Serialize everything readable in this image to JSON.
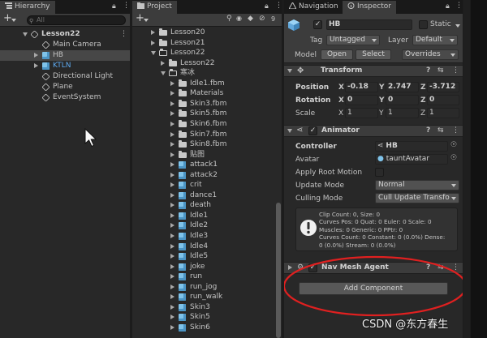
{
  "hierarchy": {
    "tab_label": "Hierarchy",
    "add_label": "+",
    "search_placeholder": "All",
    "items": [
      {
        "label": "Lesson22",
        "indent": 0,
        "expand": "down",
        "icon": "scene-icon",
        "selected": false,
        "bold": true
      },
      {
        "label": "Main Camera",
        "indent": 1,
        "expand": "",
        "icon": "gameobject-icon",
        "selected": false
      },
      {
        "label": "HB",
        "indent": 1,
        "expand": "right",
        "icon": "prefab-icon",
        "selected": true
      },
      {
        "label": "KTLN",
        "indent": 1,
        "expand": "right",
        "icon": "prefab-icon",
        "selected": false,
        "blue": true
      },
      {
        "label": "Directional Light",
        "indent": 1,
        "expand": "",
        "icon": "gameobject-icon",
        "selected": false
      },
      {
        "label": "Plane",
        "indent": 1,
        "expand": "",
        "icon": "gameobject-icon",
        "selected": false
      },
      {
        "label": "EventSystem",
        "indent": 1,
        "expand": "",
        "icon": "gameobject-icon",
        "selected": false
      }
    ]
  },
  "project": {
    "tab_label": "Project",
    "add_label": "+",
    "count_badge": "9",
    "items": [
      {
        "label": "Lesson20",
        "indent": 0,
        "expand": "right",
        "type": "folder"
      },
      {
        "label": "Lesson21",
        "indent": 0,
        "expand": "right",
        "type": "folder"
      },
      {
        "label": "Lesson22",
        "indent": 0,
        "expand": "down",
        "type": "folder-open"
      },
      {
        "label": "Lesson22",
        "indent": 1,
        "expand": "right",
        "type": "folder"
      },
      {
        "label": "寒冰",
        "indent": 1,
        "expand": "down",
        "type": "folder-open"
      },
      {
        "label": "Idle1.fbm",
        "indent": 2,
        "expand": "right",
        "type": "folder"
      },
      {
        "label": "Materials",
        "indent": 2,
        "expand": "right",
        "type": "folder"
      },
      {
        "label": "Skin3.fbm",
        "indent": 2,
        "expand": "right",
        "type": "folder"
      },
      {
        "label": "Skin5.fbm",
        "indent": 2,
        "expand": "right",
        "type": "folder"
      },
      {
        "label": "Skin6.fbm",
        "indent": 2,
        "expand": "right",
        "type": "folder"
      },
      {
        "label": "Skin7.fbm",
        "indent": 2,
        "expand": "right",
        "type": "folder"
      },
      {
        "label": "Skin8.fbm",
        "indent": 2,
        "expand": "right",
        "type": "folder"
      },
      {
        "label": "贴图",
        "indent": 2,
        "expand": "right",
        "type": "folder"
      },
      {
        "label": "attack1",
        "indent": 2,
        "expand": "right",
        "type": "model"
      },
      {
        "label": "attack2",
        "indent": 2,
        "expand": "right",
        "type": "model"
      },
      {
        "label": "crit",
        "indent": 2,
        "expand": "right",
        "type": "model"
      },
      {
        "label": "dance1",
        "indent": 2,
        "expand": "right",
        "type": "model"
      },
      {
        "label": "death",
        "indent": 2,
        "expand": "right",
        "type": "model"
      },
      {
        "label": "Idle1",
        "indent": 2,
        "expand": "right",
        "type": "model"
      },
      {
        "label": "Idle2",
        "indent": 2,
        "expand": "right",
        "type": "model"
      },
      {
        "label": "Idle3",
        "indent": 2,
        "expand": "right",
        "type": "model"
      },
      {
        "label": "Idle4",
        "indent": 2,
        "expand": "right",
        "type": "model"
      },
      {
        "label": "Idle5",
        "indent": 2,
        "expand": "right",
        "type": "model"
      },
      {
        "label": "joke",
        "indent": 2,
        "expand": "right",
        "type": "model"
      },
      {
        "label": "run",
        "indent": 2,
        "expand": "right",
        "type": "model"
      },
      {
        "label": "run_jog",
        "indent": 2,
        "expand": "right",
        "type": "model"
      },
      {
        "label": "run_walk",
        "indent": 2,
        "expand": "right",
        "type": "model"
      },
      {
        "label": "Skin3",
        "indent": 2,
        "expand": "right",
        "type": "model"
      },
      {
        "label": "Skin5",
        "indent": 2,
        "expand": "right",
        "type": "model"
      },
      {
        "label": "Skin6",
        "indent": 2,
        "expand": "right",
        "type": "model"
      }
    ]
  },
  "inspector": {
    "tabs": [
      {
        "label": "Navigation"
      },
      {
        "label": "Inspector"
      }
    ],
    "object_name": "HB",
    "static_label": "Static",
    "tag_label": "Tag",
    "tag_value": "Untagged",
    "layer_label": "Layer",
    "layer_value": "Default",
    "model_label": "Model",
    "open_label": "Open",
    "select_label": "Select",
    "overrides_label": "Overrides",
    "transform": {
      "title": "Transform",
      "rows": [
        {
          "label": "Position",
          "x": "-0.18",
          "y": "2.747",
          "z": "-3.712",
          "bold": true
        },
        {
          "label": "Rotation",
          "x": "0",
          "y": "0",
          "z": "0",
          "bold": true
        },
        {
          "label": "Scale",
          "x": "1",
          "y": "1",
          "z": "1",
          "bold": false
        }
      ],
      "axis_x": "X",
      "axis_y": "Y",
      "axis_z": "Z"
    },
    "animator": {
      "title": "Animator",
      "controller_label": "Controller",
      "controller_value": "HB",
      "avatar_label": "Avatar",
      "avatar_value": "tauntAvatar",
      "apply_root_motion_label": "Apply Root Motion",
      "update_mode_label": "Update Mode",
      "update_mode_value": "Normal",
      "culling_mode_label": "Culling Mode",
      "culling_mode_value": "Cull Update Transfo",
      "info_lines": [
        "Clip Count: 0, Size: 0",
        "Curves Pos: 0 Quat: 0 Euler: 0 Scale: 0",
        "Muscles: 0 Generic: 0 PPtr: 0",
        "Curves Count: 0 Constant: 0 (0.0%) Dense:",
        "0 (0.0%) Stream: 0 (0.0%)"
      ]
    },
    "nav_mesh_agent": {
      "title": "Nav Mesh Agent"
    },
    "add_component_label": "Add Component"
  },
  "watermark": "CSDN @东方春生",
  "colors": {
    "panel_bg": "#282828",
    "header_bg": "#3c3c3c",
    "selected_row": "#474747",
    "blue_text": "#5eaaf0",
    "annotation_red": "#e02020"
  }
}
